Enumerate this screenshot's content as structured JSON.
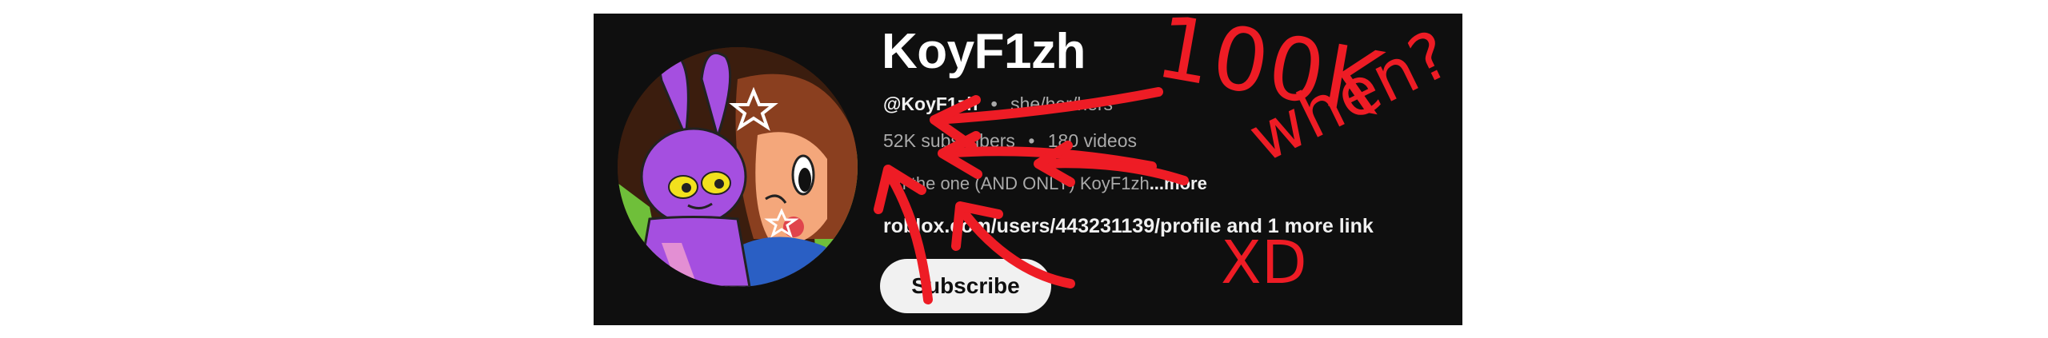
{
  "channel": {
    "name": "KoyF1zh",
    "handle": "@KoyF1zh",
    "pronouns": "she/her/hers",
    "subscribers": "52K subscribers",
    "videos": "180 videos",
    "description": "I'm the one (AND ONLY) KoyF1zh",
    "more_label": "...more",
    "link_text": "roblox.com/users/443231139/profile",
    "more_links": "and 1 more link",
    "separator": "•"
  },
  "actions": {
    "subscribe_label": "Subscribe"
  },
  "annotations": {
    "milestone": "100K",
    "question": "when?",
    "emote": "XD",
    "ink_color": "#ee1c25"
  },
  "avatar": {
    "icon": "cartoon-avatar-icon",
    "colors": {
      "bunny": "#a54fe0",
      "hair": "#8a3f1f",
      "skin": "#f4a77b",
      "shirt": "#2a5fc4",
      "background": "#6fbf3a"
    }
  },
  "theme": {
    "panel_bg": "#0f0f0f",
    "text_primary": "#f1f1f1",
    "text_secondary": "#aaaaaa",
    "button_bg": "#f1f1f1"
  }
}
